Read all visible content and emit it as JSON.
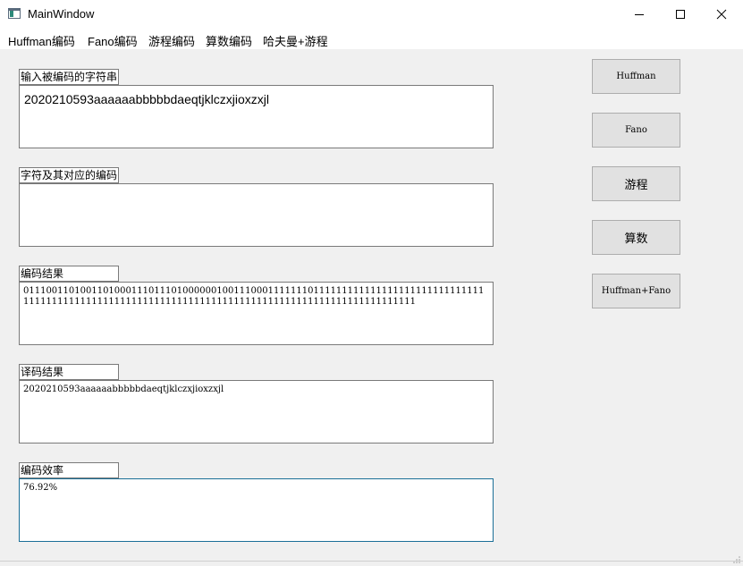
{
  "window": {
    "title": "MainWindow"
  },
  "menu": [
    "Huffman编码",
    "Fano编码",
    "游程编码",
    "算数编码",
    "哈夫曼+游程"
  ],
  "sections": [
    {
      "label": "输入被编码的字符串",
      "value": "2020210593aaaaaabbbbbdaeqtjklczxjioxzxjl"
    },
    {
      "label": "字符及其对应的编码",
      "value": ""
    },
    {
      "label": "编码结果",
      "value": "011100110100110100011101110100000010011100011111110111111111111111111111111111111111111111111111111111111111111111111111111111111111111111111111111111"
    },
    {
      "label": "译码结果",
      "value": "2020210593aaaaaabbbbbdaeqtjklczxjioxzxjl"
    },
    {
      "label": "编码效率",
      "value": "76.92%"
    }
  ],
  "buttons": [
    "Huffman",
    "Fano",
    "游程",
    "算数",
    "Huffman+Fano"
  ]
}
